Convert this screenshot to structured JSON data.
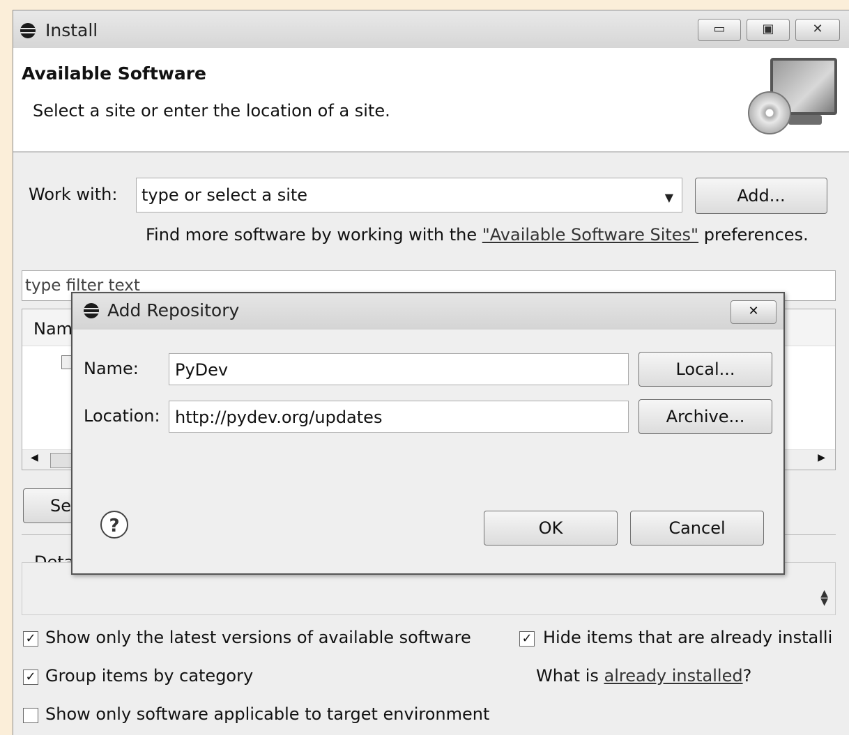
{
  "window": {
    "title": "Install",
    "minimize_glyph": "▭",
    "maximize_glyph": "▣",
    "close_glyph": "✕"
  },
  "banner": {
    "title": "Available Software",
    "subtitle": "Select a site or enter the location of a site.",
    "icon": "monitor-cd-icon"
  },
  "work_with": {
    "label": "Work with:",
    "value": "type or select a site",
    "add_button": "Add...",
    "find_more_prefix": "Find more software by working with the ",
    "find_more_link": "\"Available Software Sites\"",
    "find_more_suffix": " preferences."
  },
  "filter": {
    "value": "type filter text"
  },
  "table": {
    "column_name_partial": "Nam"
  },
  "select_button_partial": "Se",
  "details_label_partial": "Deta",
  "options": {
    "latest_versions": {
      "label": "Show only the latest versions of available software",
      "checked": true
    },
    "group_by_category": {
      "label": "Group items by category",
      "checked": true
    },
    "target_env": {
      "label": "Show only software applicable to target environment",
      "checked": false
    },
    "hide_installed": {
      "label": "Hide items that are already installi",
      "checked": true
    },
    "what_is_prefix": "What is ",
    "what_is_link": "already installed",
    "what_is_suffix": "?"
  },
  "dialog": {
    "title": "Add Repository",
    "close_glyph": "✕",
    "name_label": "Name:",
    "name_value": "PyDev",
    "location_label": "Location:",
    "location_value": "http://pydev.org/updates",
    "local_button": "Local...",
    "archive_button": "Archive...",
    "ok_button": "OK",
    "cancel_button": "Cancel",
    "help_glyph": "?"
  }
}
